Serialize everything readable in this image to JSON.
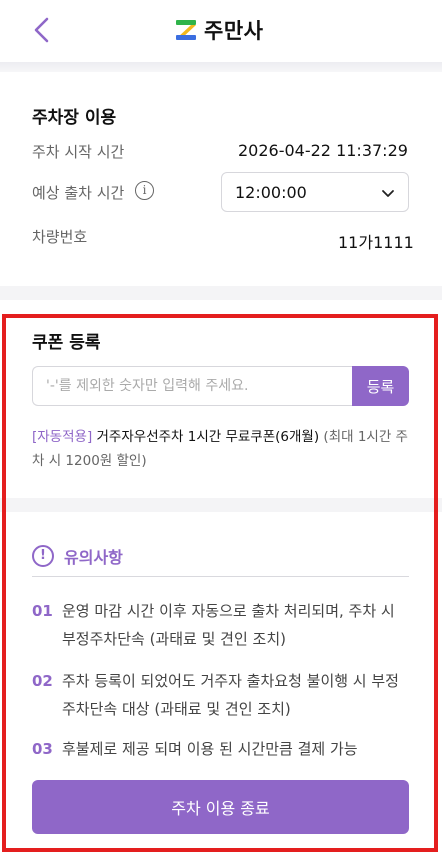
{
  "header": {
    "logo_text": "주만사",
    "back_icon": "chevron-left-icon"
  },
  "parking": {
    "title": "주차장 이용",
    "start_label": "주차 시작 시간",
    "start_value": "2026-04-22 11:37:29",
    "expected_label": "예상 출차 시간",
    "expected_value": "12:00:00",
    "plate_label": "차량번호",
    "plate_value": "11가1111"
  },
  "coupon": {
    "title": "쿠폰 등록",
    "placeholder": "'-'를 제외한 숫자만 입력해 주세요.",
    "register_label": "등록",
    "auto_tag": "[자동적용]",
    "coupon_name": "거주자우선주차 1시간 무료쿠폰(6개월)",
    "coupon_note": "(최대 1시간 주차 시 1200원 할인)"
  },
  "notice": {
    "title": "유의사항",
    "items": [
      {
        "num": "01",
        "text": "운영 마감 시간 이후 자동으로 출차 처리되며, 주차 시 부정주차단속 (과태료 및 견인 조치)"
      },
      {
        "num": "02",
        "text": "주차 등록이 되었어도 거주자 출차요청 불이행 시 부정주차단속 대상 (과태료 및 견인 조치)"
      },
      {
        "num": "03",
        "text": "후불제로 제공 되며 이용 된 시간만큼 결제 가능"
      }
    ]
  },
  "footer": {
    "end_label": "주차 이용 종료"
  },
  "colors": {
    "accent": "#8f67c8",
    "highlight_frame": "#e41e1e"
  }
}
